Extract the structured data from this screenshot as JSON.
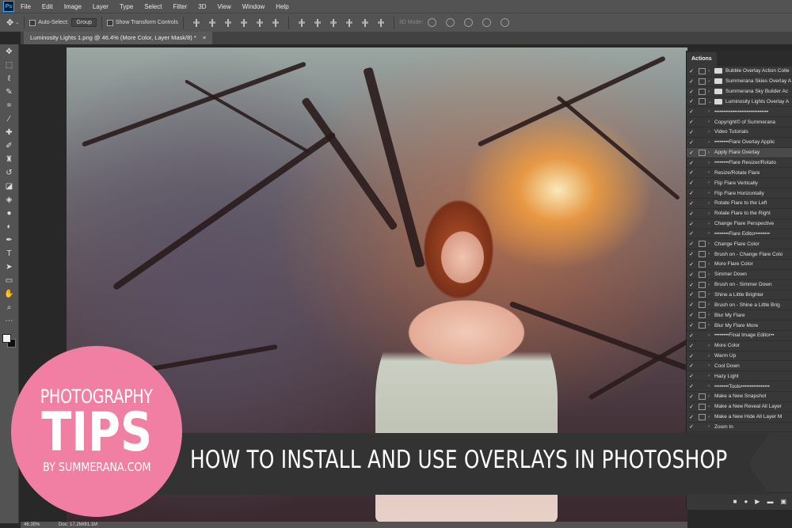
{
  "app": {
    "logo": "Ps"
  },
  "menu": [
    "File",
    "Edit",
    "Image",
    "Layer",
    "Type",
    "Select",
    "Filter",
    "3D",
    "View",
    "Window",
    "Help"
  ],
  "options": {
    "auto_select_label": "Auto-Select:",
    "auto_select_value": "Group",
    "transform_label": "Show Transform Controls",
    "mode_3d_label": "3D Mode:"
  },
  "document": {
    "tab_title": "Luminosity Lights 1.png @ 46.4% (More Color, Layer Mask/8) *"
  },
  "status": {
    "zoom": "46.35%",
    "doc": "Doc: 17.2M/81.1M"
  },
  "actions_panel": {
    "title": "Actions",
    "items": [
      {
        "label": "Bubble Overlay Action Colle",
        "checked": true,
        "dialog": true,
        "arrow": "›",
        "folder": true
      },
      {
        "label": "Summerana Skies Overlay A",
        "checked": true,
        "dialog": true,
        "arrow": "›",
        "folder": true
      },
      {
        "label": "Summerana Sky Builder Ac",
        "checked": true,
        "dialog": true,
        "arrow": "›",
        "folder": true
      },
      {
        "label": "Luminosity Lights Overlay A",
        "checked": true,
        "dialog": true,
        "arrow": "⌄",
        "folder": true
      },
      {
        "label": "••••••••••••••••••••••••••••••",
        "checked": true,
        "dialog": false,
        "arrow": "›",
        "folder": false
      },
      {
        "label": "Copyright© of Summerana",
        "checked": true,
        "dialog": false,
        "arrow": "›",
        "folder": false
      },
      {
        "label": "Video Tutorials",
        "checked": true,
        "dialog": false,
        "arrow": "›",
        "folder": false
      },
      {
        "label": "••••••••Flare Overlay Applic",
        "checked": true,
        "dialog": false,
        "arrow": "›",
        "folder": false
      },
      {
        "label": "Apply Flare Overlay",
        "checked": true,
        "dialog": true,
        "arrow": "›",
        "folder": false
      },
      {
        "label": "••••••••Flare Resizer/Rotato",
        "checked": true,
        "dialog": false,
        "arrow": "›",
        "folder": false
      },
      {
        "label": "Resize/Rotate Flare",
        "checked": true,
        "dialog": false,
        "arrow": "›",
        "folder": false
      },
      {
        "label": "Flip Flare Vertically",
        "checked": true,
        "dialog": false,
        "arrow": "›",
        "folder": false
      },
      {
        "label": "Flip Flare Horizontally",
        "checked": true,
        "dialog": false,
        "arrow": "›",
        "folder": false
      },
      {
        "label": "Rotate Flare to the Left",
        "checked": true,
        "dialog": false,
        "arrow": "›",
        "folder": false
      },
      {
        "label": "Rotate Flare to the Right",
        "checked": true,
        "dialog": false,
        "arrow": "›",
        "folder": false
      },
      {
        "label": "Change Flare Perspective",
        "checked": true,
        "dialog": false,
        "arrow": "›",
        "folder": false
      },
      {
        "label": "••••••••Flare Editor••••••••",
        "checked": true,
        "dialog": false,
        "arrow": "›",
        "folder": false
      },
      {
        "label": "Change Flare Color",
        "checked": true,
        "dialog": true,
        "arrow": "›",
        "folder": false
      },
      {
        "label": "Brush on - Change Flare Colo",
        "checked": true,
        "dialog": true,
        "arrow": "›",
        "folder": false
      },
      {
        "label": "More Flare Color",
        "checked": true,
        "dialog": true,
        "arrow": "›",
        "folder": false
      },
      {
        "label": "Simmer Down",
        "checked": true,
        "dialog": true,
        "arrow": "›",
        "folder": false
      },
      {
        "label": "Brush on - Simmer Down",
        "checked": true,
        "dialog": true,
        "arrow": "›",
        "folder": false
      },
      {
        "label": "Shine a Little Brighter",
        "checked": true,
        "dialog": true,
        "arrow": "›",
        "folder": false
      },
      {
        "label": "Brush on - Shine a Little Brig",
        "checked": true,
        "dialog": true,
        "arrow": "›",
        "folder": false
      },
      {
        "label": "Blur My Flare",
        "checked": true,
        "dialog": true,
        "arrow": "›",
        "folder": false
      },
      {
        "label": "Blur My Flare More",
        "checked": true,
        "dialog": true,
        "arrow": "›",
        "folder": false
      },
      {
        "label": "••••••••Final Image Editor••",
        "checked": true,
        "dialog": false,
        "arrow": "›",
        "folder": false
      },
      {
        "label": "More Color",
        "checked": true,
        "dialog": false,
        "arrow": "›",
        "folder": false
      },
      {
        "label": "Warm Up",
        "checked": true,
        "dialog": false,
        "arrow": "›",
        "folder": false
      },
      {
        "label": "Cool Down",
        "checked": true,
        "dialog": false,
        "arrow": "›",
        "folder": false
      },
      {
        "label": "Hazy Light",
        "checked": true,
        "dialog": false,
        "arrow": "›",
        "folder": false
      },
      {
        "label": "••••••••Tools••••••••••••••••",
        "checked": true,
        "dialog": false,
        "arrow": "›",
        "folder": false
      },
      {
        "label": "Make a New Snapshot",
        "checked": true,
        "dialog": true,
        "arrow": "›",
        "folder": false
      },
      {
        "label": "Make a New Reveal All Layer",
        "checked": true,
        "dialog": true,
        "arrow": "›",
        "folder": false
      },
      {
        "label": "Make a New Hide All Layer M",
        "checked": true,
        "dialog": true,
        "arrow": "›",
        "folder": false
      },
      {
        "label": "Zoom In",
        "checked": true,
        "dialog": false,
        "arrow": "›",
        "folder": false
      }
    ],
    "footer_icons": [
      "■",
      "●",
      "▶",
      "▬",
      "▣"
    ]
  },
  "overlay": {
    "badge_line1": "PHOTOGRAPHY",
    "badge_line2": "TIPS",
    "badge_line3": "BY SUMMERANA.COM",
    "ribbon_text": "HOW TO INSTALL AND USE OVERLAYS IN PHOTOSHOP",
    "badge_color": "#f07fa3",
    "ribbon_color": "#333333"
  }
}
